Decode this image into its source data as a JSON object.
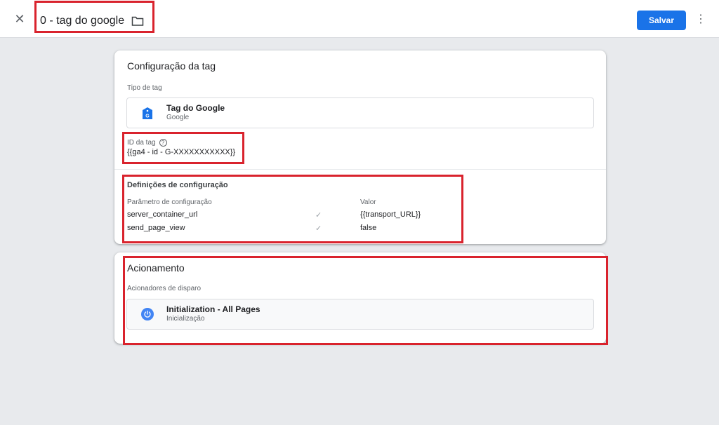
{
  "header": {
    "close_icon": "close-icon",
    "title": "0 - tag do google",
    "folder_icon": "folder-icon",
    "save_label": "Salvar",
    "more_icon": "more-vert-icon"
  },
  "config_card": {
    "title": "Configuração da tag",
    "type_label": "Tipo de tag",
    "tag_type": {
      "name": "Tag do Google",
      "vendor": "Google",
      "icon": "google-tag-icon"
    },
    "tag_id_label": "ID da tag",
    "tag_id_value": "{{ga4 - id - G-XXXXXXXXXXX}}",
    "settings": {
      "title": "Definições de configuração",
      "param_header": "Parâmetro de configuração",
      "value_header": "Valor",
      "rows": [
        {
          "param": "server_container_url",
          "value": "{{transport_URL}}"
        },
        {
          "param": "send_page_view",
          "value": "false"
        }
      ]
    }
  },
  "trigger_card": {
    "title": "Acionamento",
    "triggers_label": "Acionadores de disparo",
    "trigger": {
      "name": "Initialization - All Pages",
      "type": "Inicialização",
      "icon": "power-icon"
    }
  },
  "colors": {
    "accent": "#1a73e8",
    "highlight": "#d9232d"
  }
}
